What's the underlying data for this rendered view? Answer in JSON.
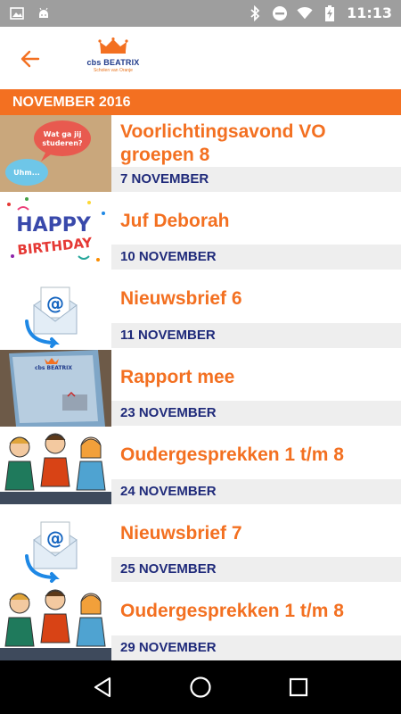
{
  "status_bar": {
    "time": "11:13",
    "icons_left": [
      "image-icon",
      "android-icon"
    ],
    "icons_right": [
      "bluetooth-icon",
      "dnd-icon",
      "wifi-icon",
      "battery-icon"
    ]
  },
  "app_bar": {
    "logo_text": "cbs BEATRIX",
    "logo_tagline": "Scholen van Oranje"
  },
  "section": {
    "month": "NOVEMBER 2016"
  },
  "items": [
    {
      "title": "Voorlichtingsavond VO groepen 8",
      "date": "7 NOVEMBER",
      "thumb": "speech-bubbles",
      "thumb_text_1": "Wat ga jij studeren?",
      "thumb_text_2": "Uhm..."
    },
    {
      "title": "Juf Deborah",
      "date": "10 NOVEMBER",
      "thumb": "birthday",
      "thumb_text_1": "HAPPY",
      "thumb_text_2": "BIRTHDAY"
    },
    {
      "title": "Nieuwsbrief 6",
      "date": "11 NOVEMBER",
      "thumb": "email"
    },
    {
      "title": "Rapport mee",
      "date": "23 NOVEMBER",
      "thumb": "report",
      "thumb_text_1": "cbs BEATRIX"
    },
    {
      "title": "Oudergesprekken 1 t/m 8",
      "date": "24 NOVEMBER",
      "thumb": "meeting"
    },
    {
      "title": "Nieuwsbrief 7",
      "date": "25 NOVEMBER",
      "thumb": "email"
    },
    {
      "title": "Oudergesprekken 1 t/m 8",
      "date": "29 NOVEMBER",
      "thumb": "meeting"
    }
  ],
  "colors": {
    "accent": "#f37021",
    "date_text": "#1f2a7a",
    "date_bg": "#eeeeee",
    "status_bar": "#9e9e9e",
    "nav_bar": "#000000"
  }
}
